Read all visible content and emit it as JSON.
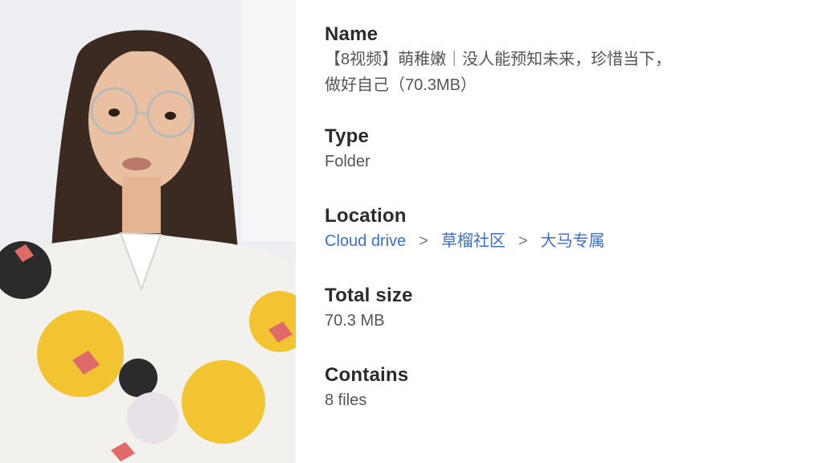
{
  "details": {
    "name": {
      "label": "Name",
      "value": "【8视频】萌稚嫩｜没人能预知未来，珍惜当下，\n做好自己（70.3MB）"
    },
    "type": {
      "label": "Type",
      "value": "Folder"
    },
    "location": {
      "label": "Location",
      "path": [
        "Cloud drive",
        "草榴社区",
        "大马专属"
      ],
      "separator": ">"
    },
    "size": {
      "label": "Total size",
      "value": "70.3 MB"
    },
    "contains": {
      "label": "Contains",
      "value": "8 files"
    }
  },
  "colors": {
    "label": "#2b2b2b",
    "value": "#555555",
    "link": "#3b6fd1",
    "background": "#ffffff"
  },
  "preview": {
    "kind": "thumbnail-photo",
    "icon": "image-thumbnail-icon"
  }
}
